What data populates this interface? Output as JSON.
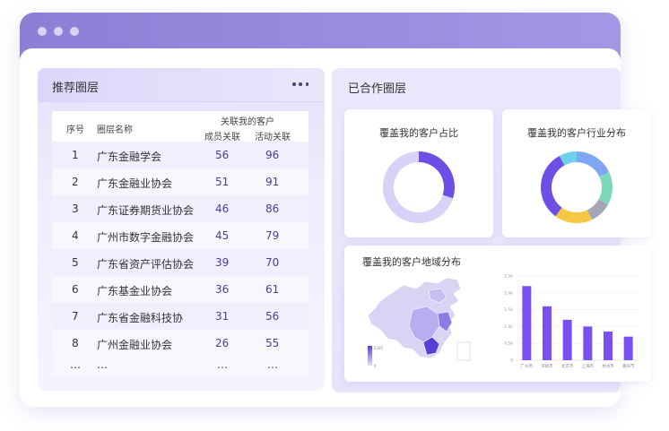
{
  "left_panel": {
    "title": "推荐圈层",
    "columns": {
      "index": "序号",
      "name": "圈层名称",
      "group": "关联我的客户",
      "member": "成员关联",
      "activity": "活动关联"
    },
    "rows": [
      {
        "index": "1",
        "name": "广东金融学会",
        "member": "56",
        "activity": "96"
      },
      {
        "index": "2",
        "name": "广东金融业协会",
        "member": "51",
        "activity": "91"
      },
      {
        "index": "3",
        "name": "广东证券期货业协会",
        "member": "46",
        "activity": "86"
      },
      {
        "index": "4",
        "name": "广州市数字金融协会",
        "member": "45",
        "activity": "79"
      },
      {
        "index": "5",
        "name": "广东省资产评估协会",
        "member": "39",
        "activity": "70"
      },
      {
        "index": "6",
        "name": "广东基金业协会",
        "member": "36",
        "activity": "61"
      },
      {
        "index": "7",
        "name": "广东省金融科技协",
        "member": "31",
        "activity": "56"
      },
      {
        "index": "8",
        "name": "广州金融业协会",
        "member": "26",
        "activity": "55"
      }
    ],
    "ellipsis": {
      "index": "…",
      "name": "…",
      "member": "…",
      "activity": "…"
    }
  },
  "right_panel": {
    "title": "已合作圈层",
    "card_share_title": "覆盖我的客户占比",
    "card_industry_title": "覆盖我的客户行业分布",
    "card_region_title": "覆盖我的客户地域分布"
  },
  "chart_data": [
    {
      "type": "pie",
      "title": "覆盖我的客户占比",
      "values": [
        0.3,
        0.7
      ],
      "colors": [
        "#6d4fe6",
        "#d7d2f6"
      ]
    },
    {
      "type": "pie",
      "title": "覆盖我的客户行业分布",
      "values": [
        0.18,
        0.15,
        0.1,
        0.17,
        0.32,
        0.08
      ],
      "colors": [
        "#7fa6f2",
        "#7dd9b7",
        "#a4a6b8",
        "#f7c744",
        "#6d4fe6",
        "#6fd0ee"
      ]
    },
    {
      "type": "bar",
      "title": "覆盖我的客户地域分布",
      "categories": [
        "广州市",
        "深圳市",
        "北京市",
        "上海市",
        "杭州市",
        "重庆市"
      ],
      "values": [
        2.2,
        1.6,
        1.2,
        1.0,
        0.85,
        0.7
      ],
      "ylim": [
        0,
        2.5
      ],
      "yticks": [
        "0",
        "0.5k",
        "1.0k",
        "1.5k",
        "2.0k",
        "2.5k"
      ],
      "color": "#7c4ff0"
    }
  ],
  "map_legend": {
    "high": "2285",
    "low": "0"
  },
  "colors": {
    "accent": "#6d4fe6",
    "titlebar": "#9a8ee0"
  },
  "icons": {
    "more": "more-icon"
  }
}
